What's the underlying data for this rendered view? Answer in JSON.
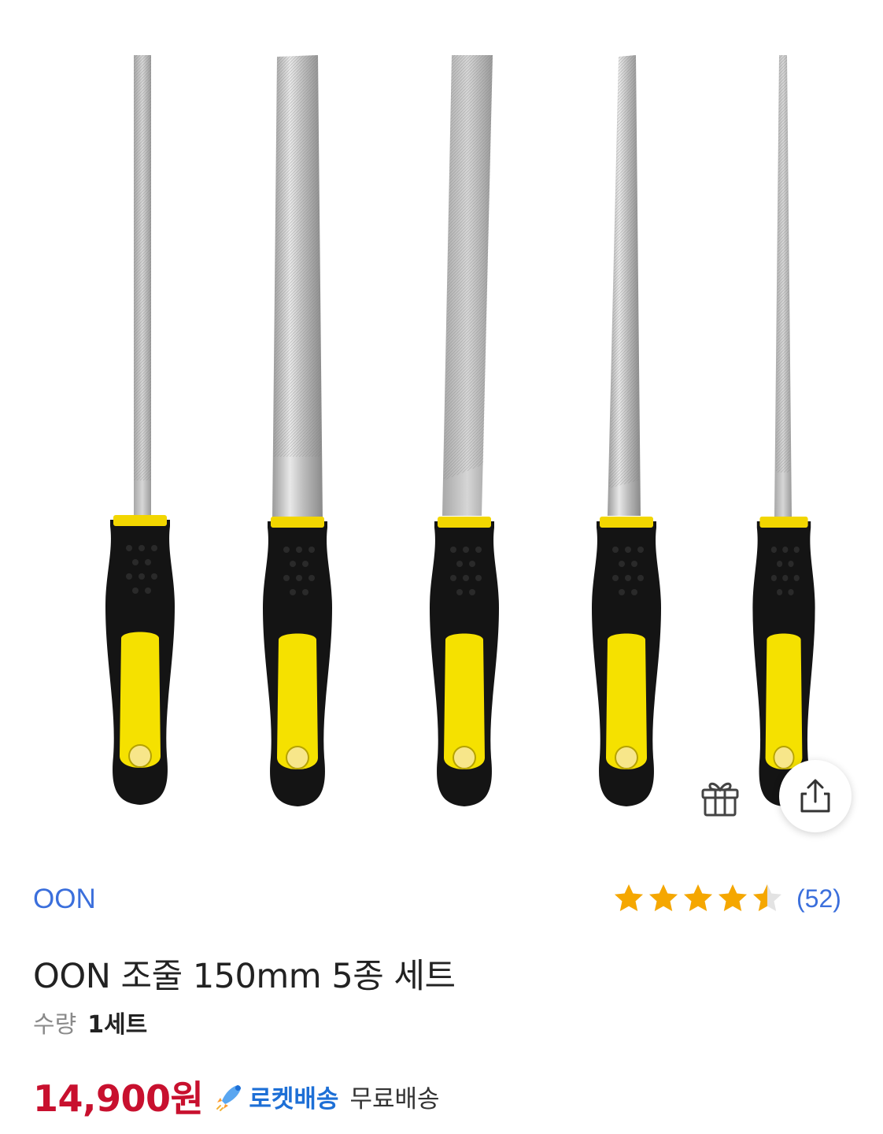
{
  "product": {
    "brand": "OON",
    "title": "OON 조줄 150mm 5종 세트",
    "quantity_label": "수량",
    "quantity_value": "1세트",
    "price": "14,900원",
    "rocket_label": "로켓배송",
    "shipping": "무료배송",
    "rating": {
      "stars": 4.5,
      "count": "(52)"
    }
  },
  "icons": {
    "gift": "gift-icon",
    "share": "share-icon",
    "star": "star-icon",
    "rocket": "rocket-icon"
  },
  "colors": {
    "brand_link": "#3b6fdc",
    "price": "#c8102e",
    "rocket": "#1d6fd6",
    "star": "#f5a700",
    "handle_yellow": "#f5e100",
    "handle_black": "#141414"
  }
}
